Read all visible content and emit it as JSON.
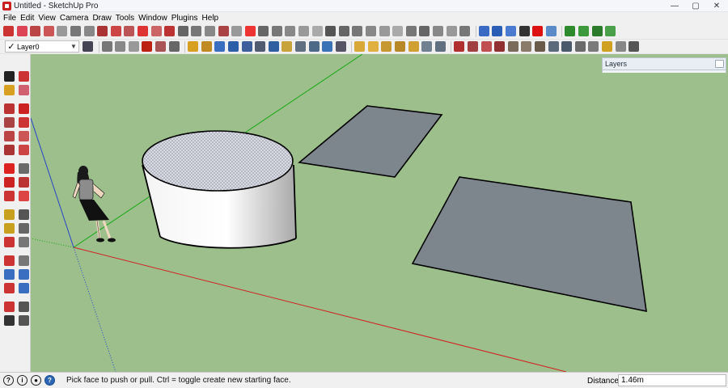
{
  "window": {
    "title": "Untitled - SketchUp Pro"
  },
  "menu": [
    "File",
    "Edit",
    "View",
    "Camera",
    "Draw",
    "Tools",
    "Window",
    "Plugins",
    "Help"
  ],
  "layer_toolbar": {
    "current_layer": "Layer0"
  },
  "panel": {
    "layers_title": "Layers"
  },
  "status": {
    "message": "Pick face to push or pull.  Ctrl = toggle create new starting face.",
    "measure_label": "Distance",
    "measure_value": "1.46m"
  },
  "colors": {
    "viewport_bg": "#9cbf8b",
    "face_gray": "#7d868d",
    "axis_red": "#d22222",
    "axis_green": "#17a817",
    "axis_blue": "#2844c8"
  }
}
